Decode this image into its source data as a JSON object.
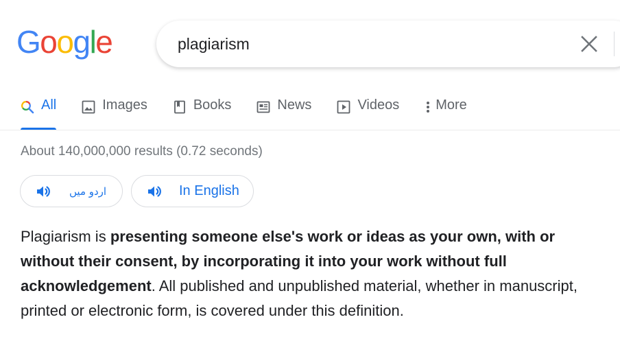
{
  "logo": {
    "letters": [
      "G",
      "o",
      "o",
      "g",
      "l",
      "e"
    ],
    "colors": [
      "#4285F4",
      "#EA4335",
      "#FBBC05",
      "#4285F4",
      "#34A853",
      "#EA4335"
    ]
  },
  "search": {
    "query": "plagiarism"
  },
  "tabs": [
    {
      "label": "All",
      "icon": "search-icon"
    },
    {
      "label": "Images",
      "icon": "image-icon"
    },
    {
      "label": "Books",
      "icon": "book-icon"
    },
    {
      "label": "News",
      "icon": "news-icon"
    },
    {
      "label": "Videos",
      "icon": "video-icon"
    },
    {
      "label": "More",
      "icon": "more-vert-icon"
    }
  ],
  "result_stats": "About 140,000,000 results (0.72 seconds)",
  "pronounce": {
    "urdu_label": "اردو میں",
    "english_label": "In English"
  },
  "definition": {
    "lead": "Plagiarism is ",
    "bold": "presenting someone else's work or ideas as your own, with or without their consent, by incorporating it into your work without full acknowledgement",
    "rest": ". All published and unpublished material, whether in manuscript, printed or electronic form, is covered under this definition."
  },
  "colors": {
    "accent": "#1a73e8",
    "tab_text": "#5f6368",
    "stats_text": "#70757a"
  }
}
